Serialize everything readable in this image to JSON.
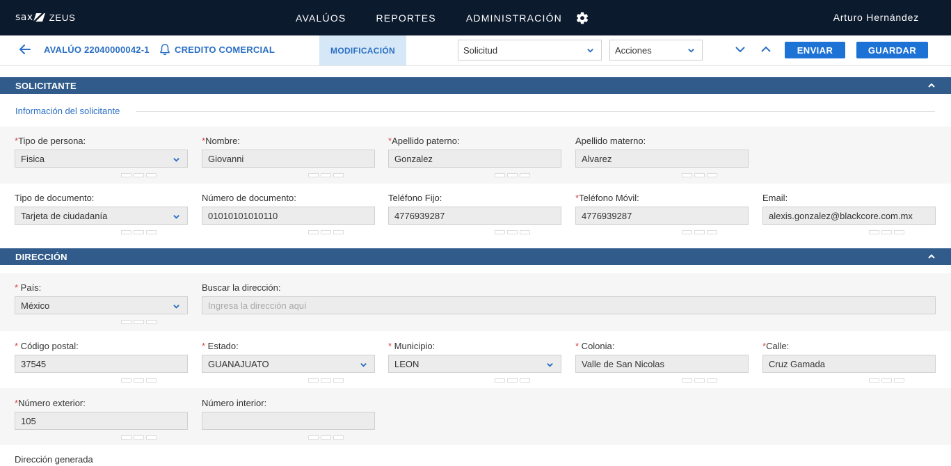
{
  "topnav": {
    "brand_logo": "sax",
    "brand_name": "ZEUS",
    "items": [
      "AVALÚOS",
      "REPORTES",
      "ADMINISTRACIÓN"
    ],
    "user": "Arturo Hernández"
  },
  "toolbar": {
    "title": "AVALÚO 22040000042-1",
    "subtitle": "CREDITO COMERCIAL",
    "tab": "MODIFICACIÓN",
    "select_solicitud": "Solicitud",
    "select_acciones": "Acciones",
    "enviar": "ENVIAR",
    "guardar": "GUARDAR"
  },
  "solicitante": {
    "header": "SOLICITANTE",
    "subheading": "Información del solicitante",
    "fields": {
      "tipo_persona": {
        "label": "Tipo de persona:",
        "value": "Fisica",
        "required": "*"
      },
      "nombre": {
        "label": "Nombre:",
        "value": "Giovanni",
        "required": "*"
      },
      "apellido_paterno": {
        "label": "Apellido paterno:",
        "value": "Gonzalez",
        "required": "*"
      },
      "apellido_materno": {
        "label": "Apellido materno:",
        "value": "Alvarez"
      },
      "tipo_documento": {
        "label": "Tipo de documento:",
        "value": "Tarjeta de ciudadanía"
      },
      "numero_documento": {
        "label": "Número de documento:",
        "value": "01010101010110"
      },
      "telefono_fijo": {
        "label": "Teléfono Fijo:",
        "value": "4776939287"
      },
      "telefono_movil": {
        "label": "Teléfono Móvil:",
        "value": "4776939287",
        "required": "*"
      },
      "email": {
        "label": "Email:",
        "value": "alexis.gonzalez@blackcore.com.mx"
      }
    }
  },
  "direccion": {
    "header": "DIRECCIÓN",
    "fields": {
      "pais": {
        "label": " País:",
        "value": "México",
        "required": "*"
      },
      "buscar": {
        "label": "Buscar la dirección:",
        "placeholder": "Ingresa la dirección aquí"
      },
      "codigo_postal": {
        "label": " Código postal:",
        "value": "37545",
        "required": "*"
      },
      "estado": {
        "label": " Estado:",
        "value": "GUANAJUATO",
        "required": "*"
      },
      "municipio": {
        "label": " Municipio:",
        "value": "LEON",
        "required": "*"
      },
      "colonia": {
        "label": " Colonia:",
        "value": "Valle de San Nicolas",
        "required": "*"
      },
      "calle": {
        "label": "Calle:",
        "value": "Cruz Gamada",
        "required": "*"
      },
      "numero_exterior": {
        "label": "Número exterior:",
        "value": "105",
        "required": "*"
      },
      "numero_interior": {
        "label": "Número interior:",
        "value": ""
      }
    },
    "generated_label": "Dirección generada"
  },
  "colors": {
    "topnav_bg": "#0c1a2e",
    "section_bg": "#305b8b",
    "accent": "#1d72d6",
    "link": "#2a6fc4",
    "required": "#d9453d",
    "tab_bg": "#d6e8f7"
  },
  "icons": {
    "back": "arrow-left-icon",
    "bell": "bell-icon",
    "gear": "gear-icon",
    "chevron_down": "chevron-down-icon",
    "chevron_up": "chevron-up-icon"
  }
}
